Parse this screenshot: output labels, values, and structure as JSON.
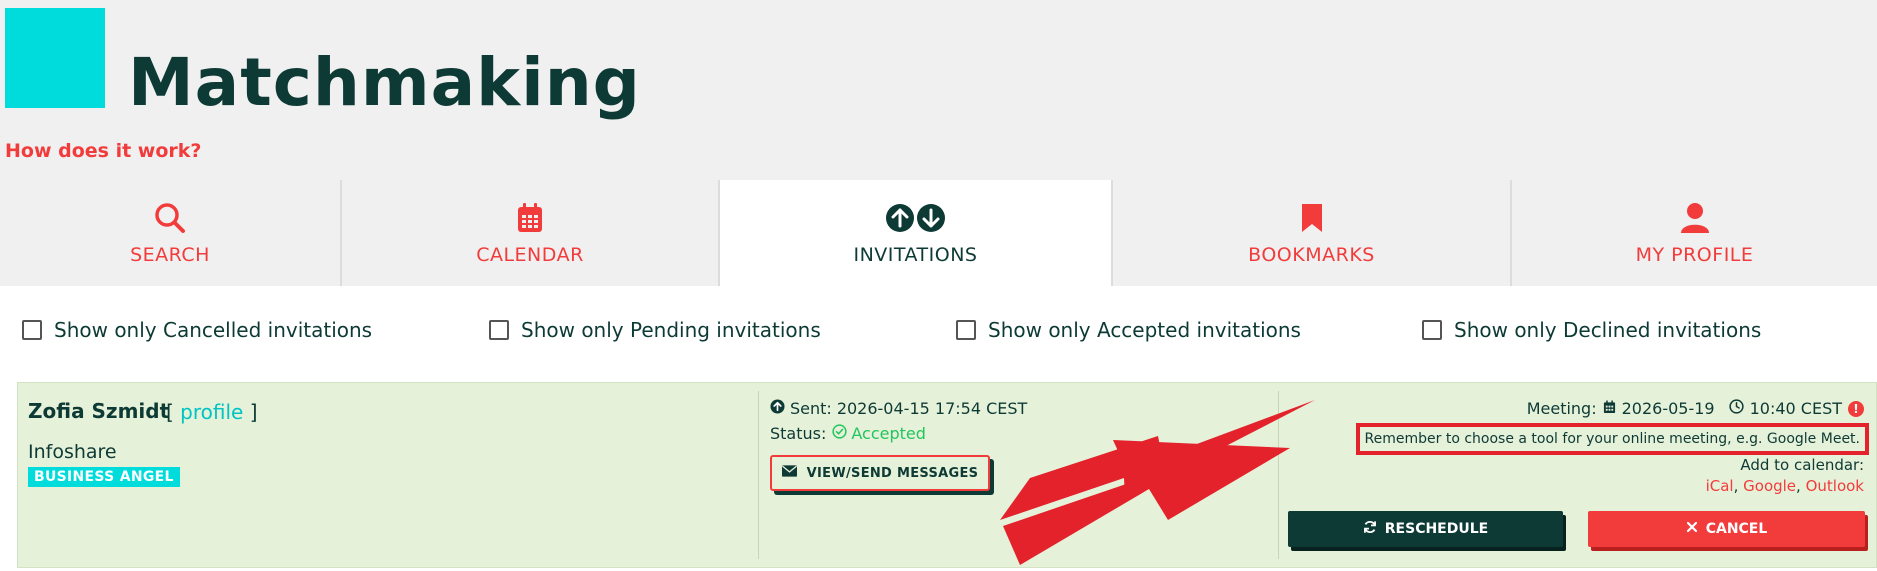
{
  "header": {
    "title": "Matchmaking",
    "help_link": "How does it work?"
  },
  "tabs": [
    {
      "label": "SEARCH",
      "icon": "search-icon",
      "active": false
    },
    {
      "label": "CALENDAR",
      "icon": "calendar-icon",
      "active": false
    },
    {
      "label": "INVITATIONS",
      "icon": "invitations-icon",
      "active": true
    },
    {
      "label": "BOOKMARKS",
      "icon": "bookmark-icon",
      "active": false
    },
    {
      "label": "MY PROFILE",
      "icon": "user-icon",
      "active": false
    }
  ],
  "filters": [
    {
      "label": "Show only Cancelled invitations",
      "checked": false
    },
    {
      "label": "Show only Pending invitations",
      "checked": false
    },
    {
      "label": "Show only Accepted invitations",
      "checked": false
    },
    {
      "label": "Show only Declined invitations",
      "checked": false
    }
  ],
  "invitation": {
    "name": "Zofia Szmidt",
    "profile_link": "profile",
    "bracket_open": "[",
    "bracket_close": "]",
    "company": "Infoshare",
    "role_badge": "BUSINESS ANGEL",
    "sent_label": "Sent:",
    "sent_value": "2026-04-15 17:54 CEST",
    "status_label": "Status:",
    "status_value": "Accepted",
    "messages_button": "VIEW/SEND MESSAGES",
    "meeting_label": "Meeting:",
    "meeting_date": "2026-05-19",
    "meeting_time": "10:40 CEST",
    "alert_symbol": "!",
    "reminder": "Remember to choose a tool for your online meeting, e.g. Google Meet.",
    "add_to_calendar": "Add to calendar:",
    "calendar_links": [
      "iCal",
      "Google",
      "Outlook"
    ],
    "reschedule_button": "RESCHEDULE",
    "cancel_button": "CANCEL"
  },
  "colors": {
    "brand_dark": "#0d3a35",
    "accent_red": "#f23c3c",
    "accent_cyan": "#00dcdc",
    "card_bg": "#e6f1d9",
    "status_green": "#22c55e",
    "annotation_red": "#e3222c"
  }
}
